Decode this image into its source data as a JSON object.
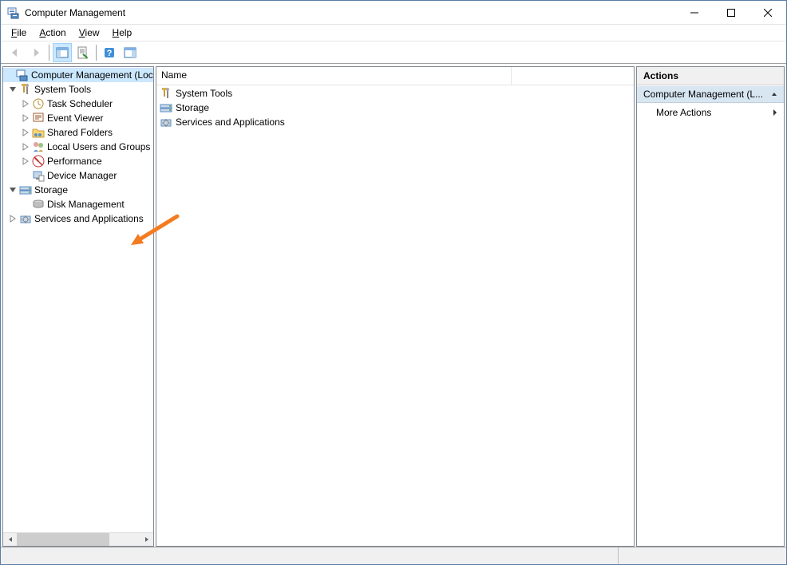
{
  "window": {
    "title": "Computer Management"
  },
  "menu": {
    "file": "File",
    "action": "Action",
    "view": "View",
    "help": "Help"
  },
  "tree": {
    "root": "Computer Management (Local)",
    "system_tools": "System Tools",
    "task_scheduler": "Task Scheduler",
    "event_viewer": "Event Viewer",
    "shared_folders": "Shared Folders",
    "local_users": "Local Users and Groups",
    "performance": "Performance",
    "device_manager": "Device Manager",
    "storage": "Storage",
    "disk_management": "Disk Management",
    "services_apps": "Services and Applications"
  },
  "list": {
    "col_name": "Name",
    "items": {
      "system_tools": "System Tools",
      "storage": "Storage",
      "services_apps": "Services and Applications"
    }
  },
  "actions": {
    "header": "Actions",
    "section": "Computer Management (L...",
    "more": "More Actions"
  }
}
